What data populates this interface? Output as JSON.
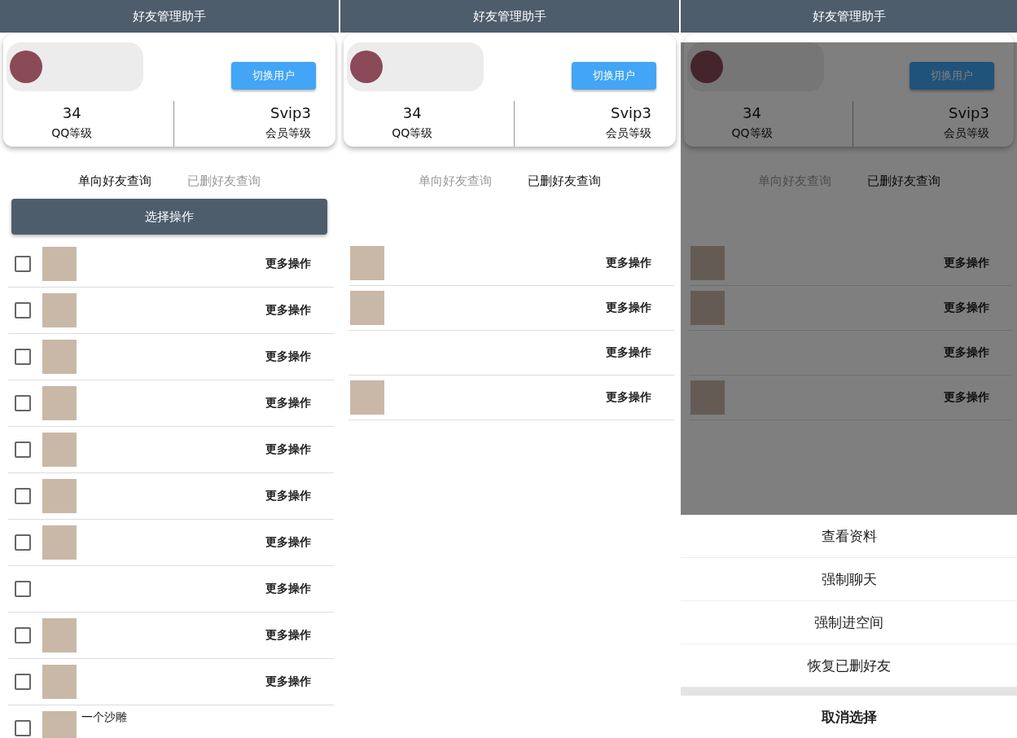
{
  "screens": [
    {
      "title": "好友管理助手",
      "dimmed": false,
      "profile": {
        "switch_button": "切换用户",
        "stats": [
          {
            "value": "34",
            "label": "QQ等级"
          },
          {
            "value": "Svip3",
            "label": "会员等级"
          }
        ]
      },
      "tabs": [
        {
          "label": "单向好友查询",
          "selected": true
        },
        {
          "label": "已删好友查询",
          "selected": false
        }
      ],
      "select_button": "选择操作",
      "friends": [
        {
          "has_avatar": true,
          "checked": false,
          "action": "更多操作"
        },
        {
          "has_avatar": true,
          "checked": false,
          "action": "更多操作"
        },
        {
          "has_avatar": true,
          "checked": false,
          "action": "更多操作"
        },
        {
          "has_avatar": true,
          "checked": false,
          "action": "更多操作"
        },
        {
          "has_avatar": true,
          "checked": false,
          "action": "更多操作"
        },
        {
          "has_avatar": true,
          "checked": false,
          "action": "更多操作"
        },
        {
          "has_avatar": true,
          "checked": false,
          "action": "更多操作"
        },
        {
          "has_avatar": false,
          "checked": false,
          "action": "更多操作"
        },
        {
          "has_avatar": true,
          "checked": false,
          "action": "更多操作"
        },
        {
          "has_avatar": true,
          "checked": false,
          "action": "更多操作"
        },
        {
          "has_avatar": true,
          "checked": false,
          "name": "一个沙雕"
        }
      ]
    },
    {
      "title": "好友管理助手",
      "dimmed": false,
      "profile": {
        "switch_button": "切换用户",
        "stats": [
          {
            "value": "34",
            "label": "QQ等级"
          },
          {
            "value": "Svip3",
            "label": "会员等级"
          }
        ]
      },
      "tabs": [
        {
          "label": "单向好友查询",
          "selected": false
        },
        {
          "label": "已删好友查询",
          "selected": true
        }
      ],
      "friends": [
        {
          "has_avatar": true,
          "action": "更多操作"
        },
        {
          "has_avatar": true,
          "action": "更多操作"
        },
        {
          "has_avatar": false,
          "action": "更多操作"
        },
        {
          "has_avatar": true,
          "action": "更多操作"
        }
      ]
    },
    {
      "title": "好友管理助手",
      "dimmed": true,
      "profile": {
        "switch_button": "切换用户",
        "stats": [
          {
            "value": "34",
            "label": "QQ等级"
          },
          {
            "value": "Svip3",
            "label": "会员等级"
          }
        ]
      },
      "tabs": [
        {
          "label": "单向好友查询",
          "selected": false
        },
        {
          "label": "已删好友查询",
          "selected": true
        }
      ],
      "friends": [
        {
          "has_avatar": true,
          "action": "更多操作"
        },
        {
          "has_avatar": true,
          "action": "更多操作"
        },
        {
          "has_avatar": false,
          "action": "更多操作"
        },
        {
          "has_avatar": true,
          "action": "更多操作"
        }
      ],
      "action_sheet": {
        "items": [
          "查看资料",
          "强制聊天",
          "强制进空间",
          "恢复已删好友"
        ],
        "cancel": "取消选择"
      }
    }
  ]
}
